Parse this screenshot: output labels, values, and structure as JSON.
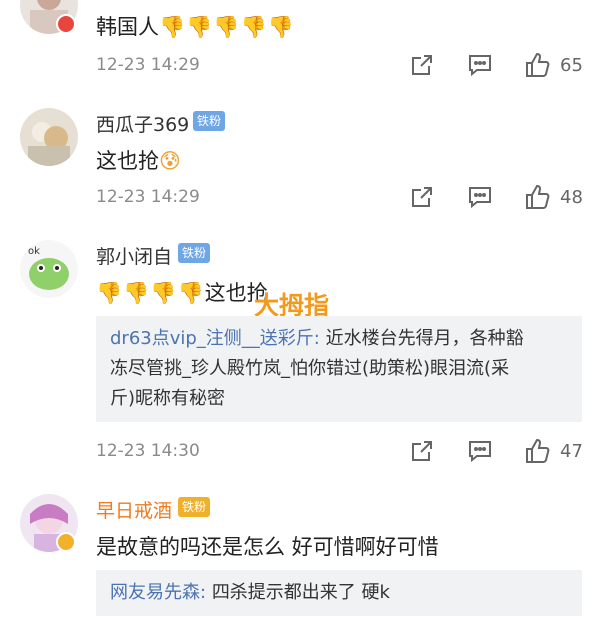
{
  "comments": [
    {
      "username": "",
      "text": "韩国人",
      "emojis": "👎👎👎👎👎",
      "time": "12-23 14:29",
      "likes": "65",
      "avatar_badge_color": "#e8453c"
    },
    {
      "username": "西瓜子369",
      "fan_badge": "铁粉",
      "text": "这也抢",
      "emoji_after": "😰",
      "time": "12-23 14:29",
      "likes": "48"
    },
    {
      "username": "郭小闭自",
      "fan_badge": "铁粉",
      "emojis": "👎👎👎👎",
      "text": "这也抢",
      "time": "12-23 14:30",
      "likes": "47",
      "reply": {
        "author": "dr63点vip_注侧__送彩斤:",
        "lines": [
          "近水楼台先得月，各种豁",
          "冻尽管挑_珍人殿竹岚_怕你错过(助策松)眼泪流(采",
          "斤)昵称有秘密"
        ]
      }
    },
    {
      "username": "早日戒酒",
      "fan_badge": "铁粉",
      "text": "是故意的吗还是怎么 好可惜啊好可惜",
      "avatar_badge_color": "#f1b12a",
      "reply": {
        "author": "网友易先森:",
        "lines": [
          "四杀提示都出来了 硬k"
        ]
      }
    }
  ],
  "overlay_label": "大拇指",
  "icons": [
    "share-icon",
    "comment-icon",
    "like-icon"
  ],
  "colors": {
    "fan_badge": "#6ea6e6",
    "accent_orange": "#f17a1c",
    "reply_link": "#4b73b2"
  }
}
